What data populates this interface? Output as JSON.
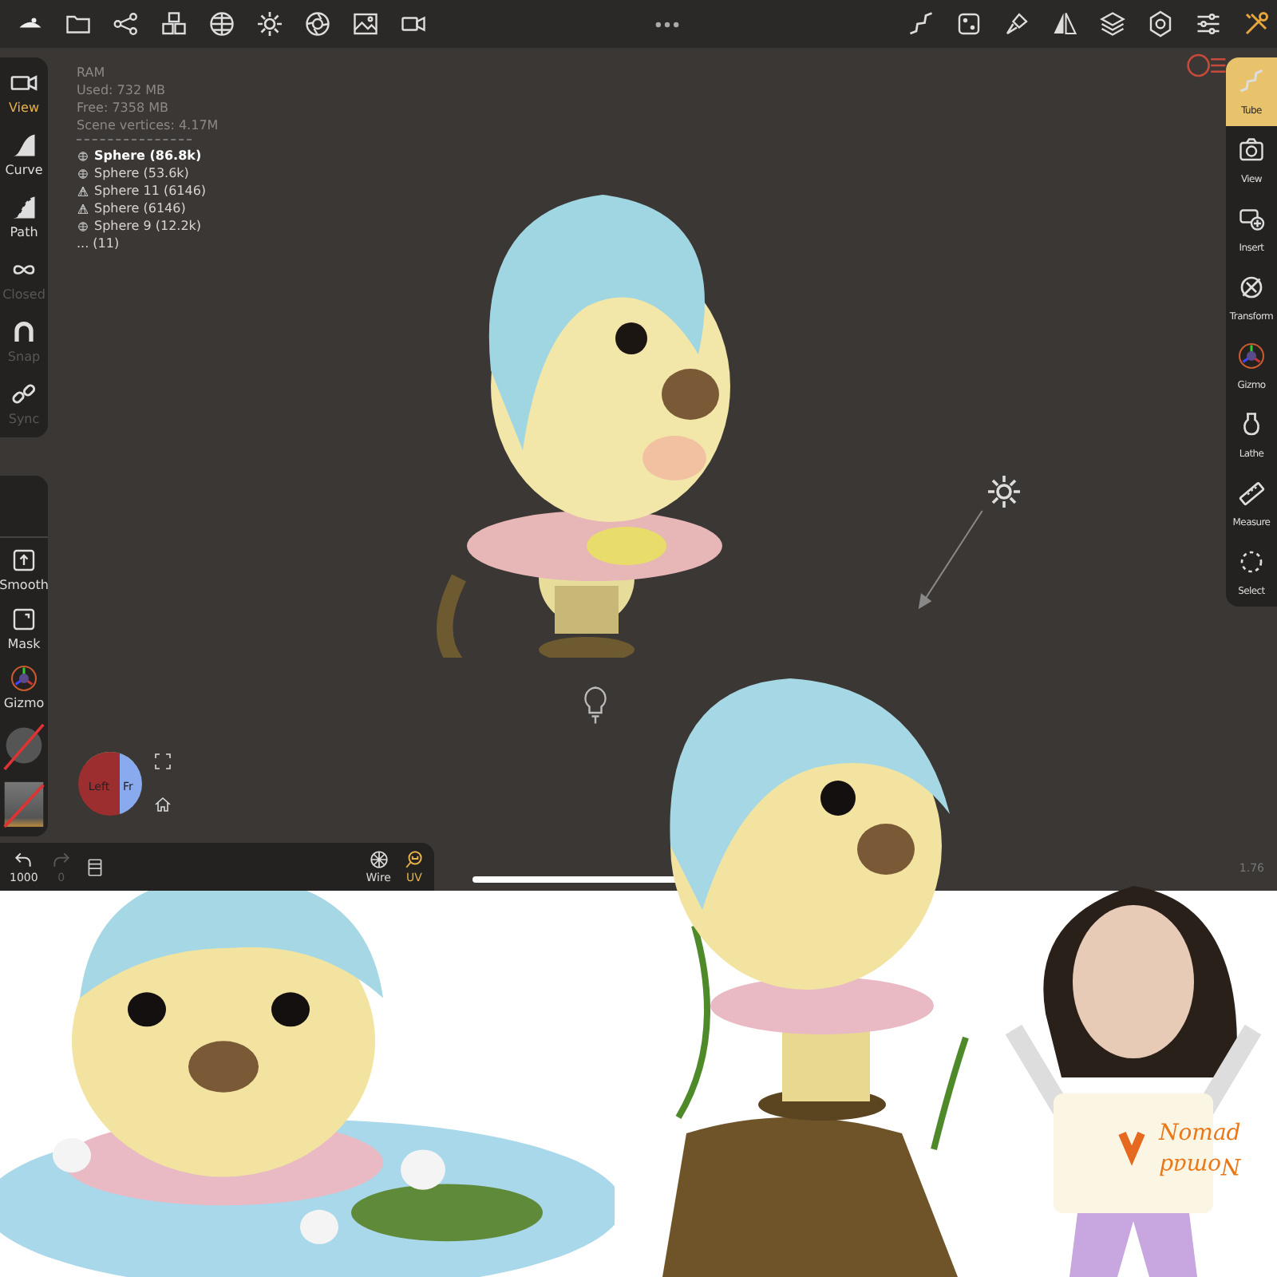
{
  "left_toolbar": {
    "items": [
      {
        "label": "View",
        "selected": true,
        "disabled": false
      },
      {
        "label": "Curve",
        "selected": false,
        "disabled": false
      },
      {
        "label": "Path",
        "selected": false,
        "disabled": false
      },
      {
        "label": "Closed",
        "selected": false,
        "disabled": true
      },
      {
        "label": "Snap",
        "selected": false,
        "disabled": true
      },
      {
        "label": "Sync",
        "selected": false,
        "disabled": true
      }
    ]
  },
  "left_lower_toolbar": {
    "items": [
      {
        "label": "Smooth"
      },
      {
        "label": "Mask"
      },
      {
        "label": "Gizmo"
      }
    ]
  },
  "stats": [
    "RAM",
    "Used: 732 MB",
    "Free: 7358 MB",
    "Scene vertices: 4.17M"
  ],
  "scene_list": {
    "items": [
      {
        "name": "Sphere (86.8k)",
        "kind": "sphere",
        "selected": true
      },
      {
        "name": "Sphere (53.6k)",
        "kind": "sphere",
        "selected": false
      },
      {
        "name": "Sphere 11 (6146)",
        "kind": "mesh",
        "selected": false
      },
      {
        "name": "Sphere (6146)",
        "kind": "mesh",
        "selected": false
      },
      {
        "name": "Sphere 9 (12.2k)",
        "kind": "sphere",
        "selected": false
      }
    ],
    "more": "... (11)"
  },
  "right_toolbar": {
    "items": [
      {
        "label": "Tube",
        "selected": true
      },
      {
        "label": "View",
        "selected": false
      },
      {
        "label": "Insert",
        "selected": false
      },
      {
        "label": "Transform",
        "selected": false
      },
      {
        "label": "Gizmo",
        "selected": false
      },
      {
        "label": "Lathe",
        "selected": false
      },
      {
        "label": "Measure",
        "selected": false
      },
      {
        "label": "Select",
        "selected": false
      }
    ]
  },
  "view_cube": {
    "faces": [
      "Left",
      "Fr"
    ]
  },
  "bottom_toolbar": {
    "undo": "1000",
    "redo": "0",
    "items": [
      {
        "label": "Wire",
        "selected": false
      },
      {
        "label": "UV",
        "selected": true
      }
    ]
  },
  "version": "1.76",
  "handwriting": [
    {
      "text": "Nomad",
      "upside_down": false
    },
    {
      "text": "Nomad",
      "upside_down": true
    }
  ]
}
